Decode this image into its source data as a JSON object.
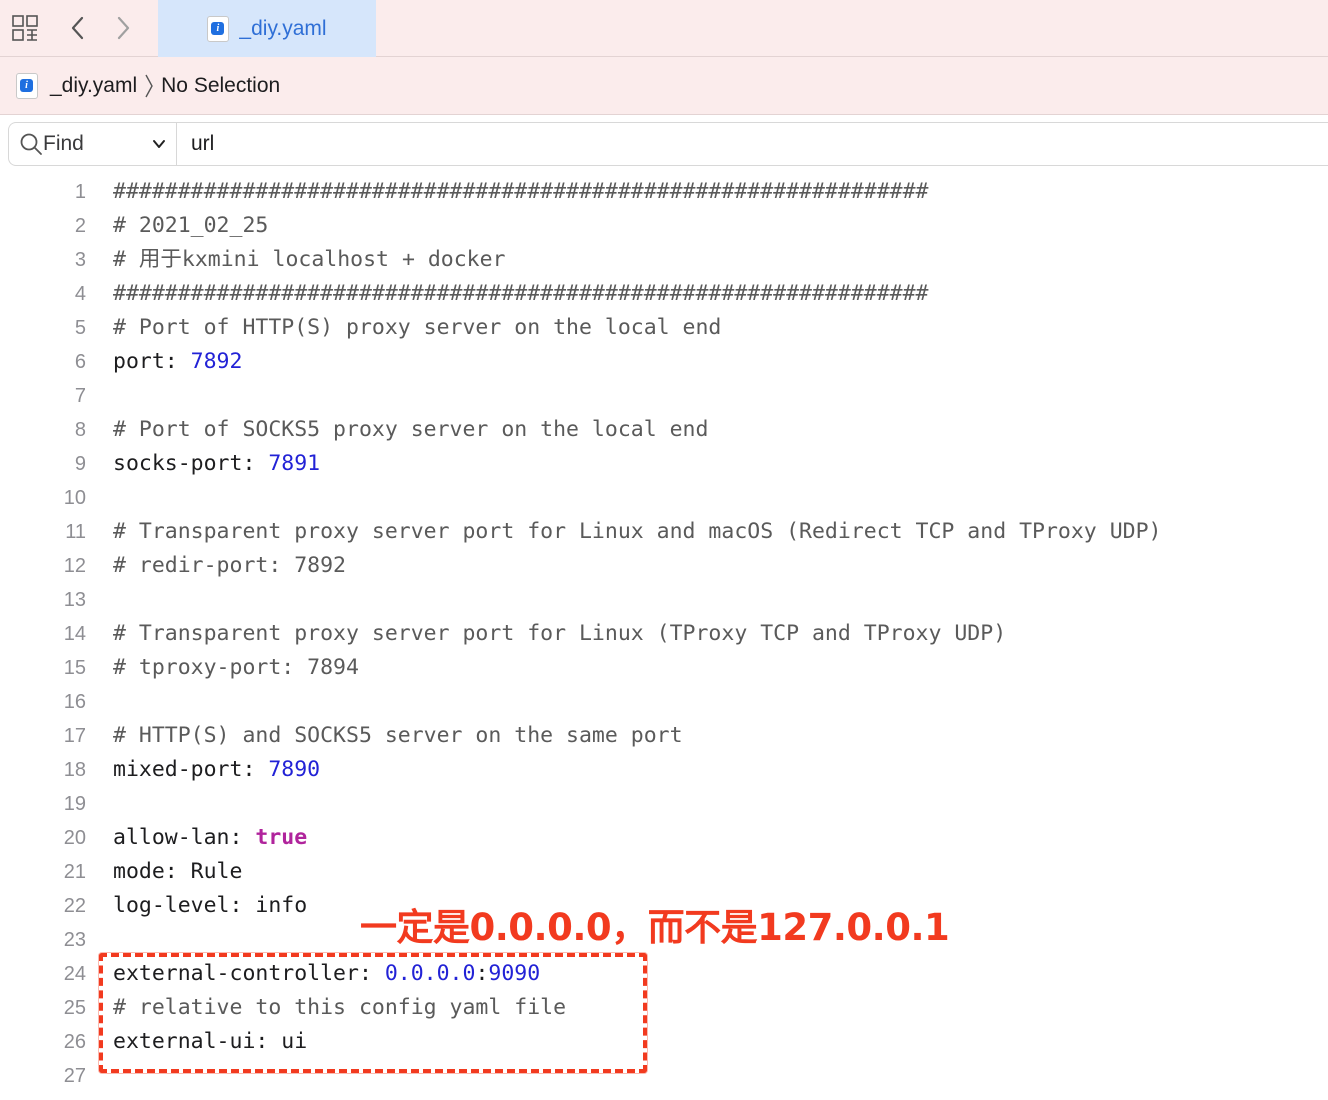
{
  "tab": {
    "title": "_diy.yaml"
  },
  "jumpbar": {
    "file": "_diy.yaml",
    "selection": "No Selection"
  },
  "find": {
    "mode": "Find",
    "query": "url"
  },
  "icons": {
    "grid": "grid-view-icon",
    "back": "chevron-left-icon",
    "forward": "chevron-right-icon",
    "file": "yaml-file-icon",
    "search": "magnifier-icon",
    "dropdown": "chevron-down-icon",
    "breadcrumb_sep": "chevron-right-icon"
  },
  "colors": {
    "annotation": "#f23a1f",
    "number": "#2222d6",
    "keyword": "#b0249c",
    "tab_active": "#d6e6fb"
  },
  "annotation": {
    "text": "一定是0.0.0.0，而不是127.0.0.1"
  },
  "lines": [
    {
      "n": "1",
      "segs": [
        {
          "t": "c",
          "v": "###############################################################"
        }
      ]
    },
    {
      "n": "2",
      "segs": [
        {
          "t": "c",
          "v": "# 2021_02_25"
        }
      ]
    },
    {
      "n": "3",
      "segs": [
        {
          "t": "c",
          "v": "# 用于kxmini localhost + docker"
        }
      ]
    },
    {
      "n": "4",
      "segs": [
        {
          "t": "c",
          "v": "###############################################################"
        }
      ]
    },
    {
      "n": "5",
      "segs": [
        {
          "t": "c",
          "v": "# Port of HTTP(S) proxy server on the local end"
        }
      ]
    },
    {
      "n": "6",
      "segs": [
        {
          "t": "p",
          "v": "port: "
        },
        {
          "t": "n",
          "v": "7892"
        }
      ]
    },
    {
      "n": "7",
      "segs": []
    },
    {
      "n": "8",
      "segs": [
        {
          "t": "c",
          "v": "# Port of SOCKS5 proxy server on the local end"
        }
      ]
    },
    {
      "n": "9",
      "segs": [
        {
          "t": "p",
          "v": "socks-port: "
        },
        {
          "t": "n",
          "v": "7891"
        }
      ]
    },
    {
      "n": "10",
      "segs": []
    },
    {
      "n": "11",
      "segs": [
        {
          "t": "c",
          "v": "# Transparent proxy server port for Linux and macOS (Redirect TCP and TProxy UDP)"
        }
      ]
    },
    {
      "n": "12",
      "segs": [
        {
          "t": "c",
          "v": "# redir-port: 7892"
        }
      ]
    },
    {
      "n": "13",
      "segs": []
    },
    {
      "n": "14",
      "segs": [
        {
          "t": "c",
          "v": "# Transparent proxy server port for Linux (TProxy TCP and TProxy UDP)"
        }
      ]
    },
    {
      "n": "15",
      "segs": [
        {
          "t": "c",
          "v": "# tproxy-port: 7894"
        }
      ]
    },
    {
      "n": "16",
      "segs": []
    },
    {
      "n": "17",
      "segs": [
        {
          "t": "c",
          "v": "# HTTP(S) and SOCKS5 server on the same port"
        }
      ]
    },
    {
      "n": "18",
      "segs": [
        {
          "t": "p",
          "v": "mixed-port: "
        },
        {
          "t": "n",
          "v": "7890"
        }
      ]
    },
    {
      "n": "19",
      "segs": []
    },
    {
      "n": "20",
      "segs": [
        {
          "t": "p",
          "v": "allow-lan: "
        },
        {
          "t": "k",
          "v": "true"
        }
      ]
    },
    {
      "n": "21",
      "segs": [
        {
          "t": "p",
          "v": "mode: Rule"
        }
      ]
    },
    {
      "n": "22",
      "segs": [
        {
          "t": "p",
          "v": "log-level: info"
        }
      ]
    },
    {
      "n": "23",
      "segs": []
    },
    {
      "n": "24",
      "segs": [
        {
          "t": "p",
          "v": "external-controller: "
        },
        {
          "t": "n",
          "v": "0.0.0.0"
        },
        {
          "t": "p",
          "v": ":"
        },
        {
          "t": "n",
          "v": "9090"
        }
      ]
    },
    {
      "n": "25",
      "segs": [
        {
          "t": "c",
          "v": "# relative to this config yaml file"
        }
      ]
    },
    {
      "n": "26",
      "segs": [
        {
          "t": "p",
          "v": "external-ui: ui"
        }
      ]
    },
    {
      "n": "27",
      "segs": []
    }
  ]
}
